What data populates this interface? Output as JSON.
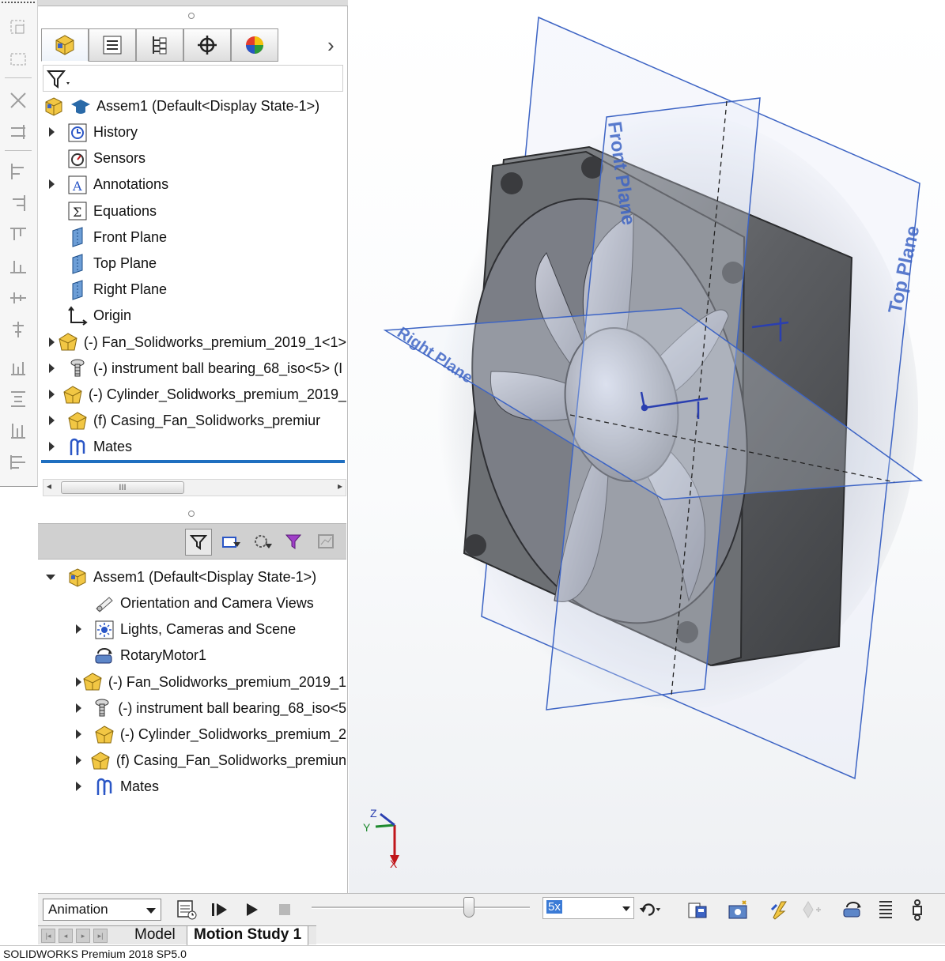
{
  "feature_tree": {
    "tabs": [
      {
        "icon": "featuremanager-tree-icon",
        "active": true
      },
      {
        "icon": "property-manager-icon"
      },
      {
        "icon": "configuration-manager-icon"
      },
      {
        "icon": "dimxpert-manager-icon"
      },
      {
        "icon": "display-manager-icon"
      }
    ],
    "root_label": "Assem1  (Default<Display State-1>)",
    "items": [
      {
        "label": "History",
        "icon": "history-icon",
        "expandable": true
      },
      {
        "label": "Sensors",
        "icon": "sensors-icon",
        "expandable": false
      },
      {
        "label": "Annotations",
        "icon": "annotations-icon",
        "expandable": true
      },
      {
        "label": "Equations",
        "icon": "equations-icon",
        "expandable": false
      },
      {
        "label": "Front Plane",
        "icon": "plane-icon",
        "expandable": false
      },
      {
        "label": "Top Plane",
        "icon": "plane-icon",
        "expandable": false
      },
      {
        "label": "Right Plane",
        "icon": "plane-icon",
        "expandable": false
      },
      {
        "label": "Origin",
        "icon": "origin-icon",
        "expandable": false
      },
      {
        "label": "(-) Fan_Solidworks_premium_2019_1<1>",
        "icon": "part-icon",
        "expandable": true
      },
      {
        "label": "(-) instrument ball bearing_68_iso<5> (I",
        "icon": "toolbox-part-icon",
        "expandable": true
      },
      {
        "label": "(-) Cylinder_Solidworks_premium_2019_",
        "icon": "part-icon",
        "expandable": true
      },
      {
        "label": "(f) Casing_Fan_Solidworks_premiur",
        "icon": "part-icon",
        "expandable": true
      },
      {
        "label": "Mates",
        "icon": "mates-icon",
        "expandable": true
      }
    ],
    "scroll_thumb": "III"
  },
  "motion_tree": {
    "root_label": "Assem1  (Default<Display State-1>)",
    "items": [
      {
        "label": "Orientation and Camera Views",
        "icon": "camera-views-icon",
        "expandable": false
      },
      {
        "label": "Lights, Cameras and Scene",
        "icon": "lights-icon",
        "expandable": true
      },
      {
        "label": "RotaryMotor1",
        "icon": "rotary-motor-icon",
        "expandable": false
      },
      {
        "label": "(-) Fan_Solidworks_premium_2019_1",
        "icon": "part-icon",
        "expandable": true
      },
      {
        "label": "(-) instrument ball bearing_68_iso<5",
        "icon": "toolbox-part-icon",
        "expandable": true
      },
      {
        "label": "(-) Cylinder_Solidworks_premium_2",
        "icon": "part-icon",
        "expandable": true
      },
      {
        "label": "(f) Casing_Fan_Solidworks_premiun",
        "icon": "part-icon",
        "expandable": true
      },
      {
        "label": "Mates",
        "icon": "mates-icon",
        "expandable": true
      }
    ]
  },
  "viewport": {
    "planes": [
      "Front Plane",
      "Top Plane",
      "Right Plane"
    ],
    "triad_axes": [
      "Z",
      "Y",
      "X"
    ]
  },
  "motion_controls": {
    "study_type": "Animation",
    "playback_speed": "5x"
  },
  "bottom_tabs": [
    "Model",
    "Motion Study 1"
  ],
  "status_bar": "SOLIDWORKS Premium 2018 SP5.0",
  "colors": {
    "plane_blue": "#3d64c4",
    "selection_blue": "#1f6fc0",
    "part_yellow": "#f2c744",
    "fan_gray": "#6f7174"
  }
}
